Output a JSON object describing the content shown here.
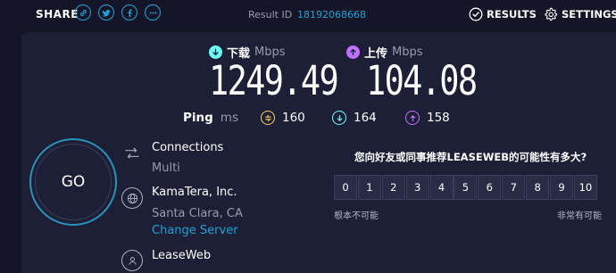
{
  "header": {
    "share_label": "SHARE",
    "share_icons": [
      "link-icon",
      "twitter-icon",
      "facebook-icon",
      "more-icon"
    ],
    "result_label": "Result ID",
    "result_id": "18192068668",
    "results_label": "RESULTS",
    "settings_label": "SETTINGS"
  },
  "download": {
    "label": "下载",
    "unit": "Mbps",
    "value": "1249.49",
    "color": "#6afff3"
  },
  "upload": {
    "label": "上传",
    "unit": "Mbps",
    "value": "104.08",
    "color": "#bf71ff"
  },
  "ping": {
    "label": "Ping",
    "unit": "ms",
    "idle": "160",
    "download": "164",
    "upload": "158",
    "idle_color": "#fbd561"
  },
  "go_label": "GO",
  "connection": {
    "title": "Connections",
    "value": "Multi"
  },
  "isp": {
    "name": "KamaTera, Inc.",
    "location": "Santa Clara, CA"
  },
  "server": {
    "change_label": "Change Server",
    "name": "LeaseWeb"
  },
  "survey": {
    "question": "您向好友或同事推荐LEASEWEB的可能性有多大?",
    "scale": [
      "0",
      "1",
      "2",
      "3",
      "4",
      "5",
      "6",
      "7",
      "8",
      "9",
      "10"
    ],
    "low_label": "根本不可能",
    "high_label": "非常有可能"
  },
  "colors": {
    "accent": "#1fa1d8",
    "background": "#141526",
    "panel": "#1d1f36"
  }
}
